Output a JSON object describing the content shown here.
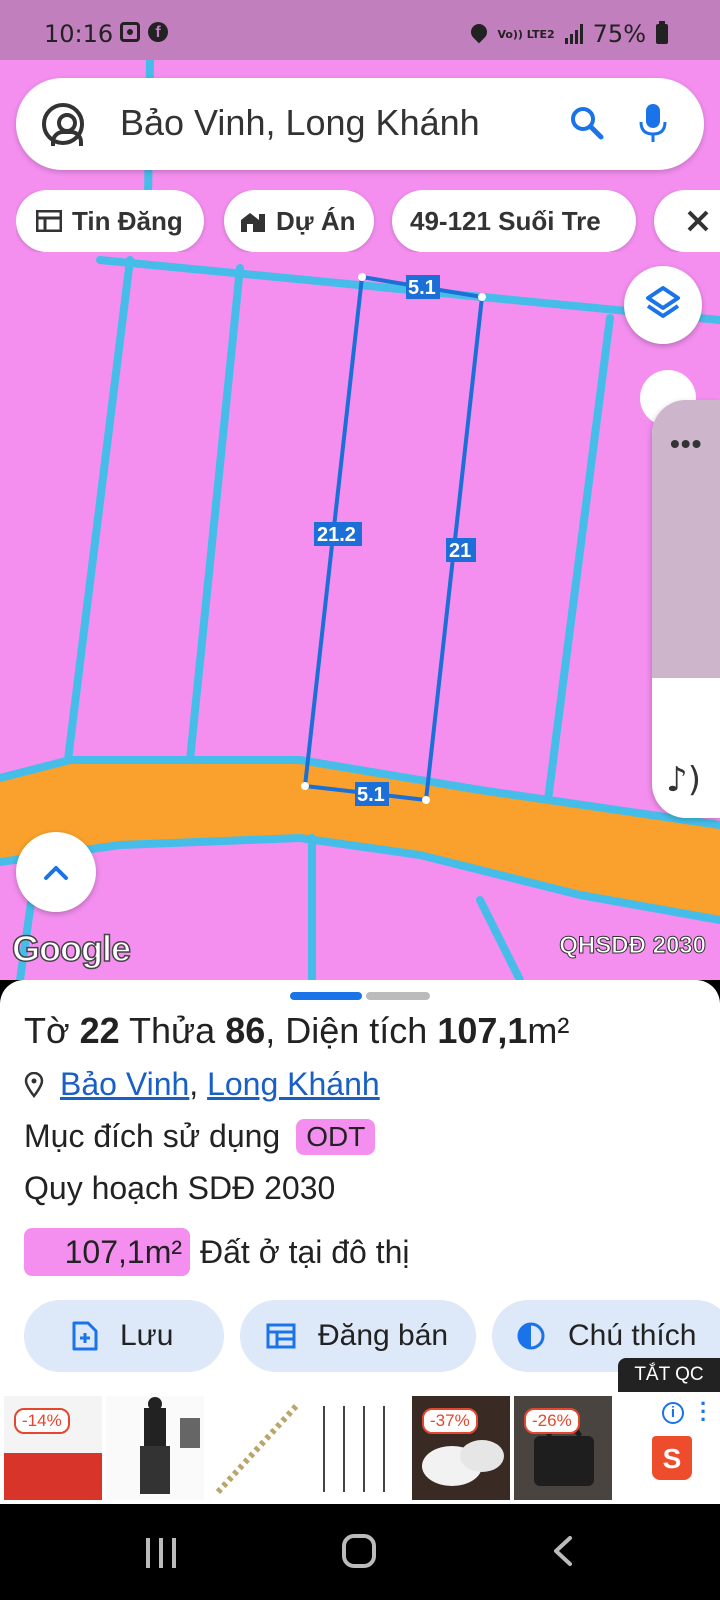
{
  "status_bar": {
    "time": "10:16",
    "network": "Vo)) LTE2",
    "battery": "75%"
  },
  "search": {
    "query": "Bảo Vinh, Long Khánh"
  },
  "chips": [
    {
      "label": "Tin Đăng"
    },
    {
      "label": "Dự Án"
    },
    {
      "label": "49-121 Suối Tre"
    }
  ],
  "map": {
    "edge_labels": [
      "5.1",
      "21.2",
      "21",
      "5.1"
    ],
    "attribution": "Google",
    "layer_label": "QHSDĐ 2030",
    "colors": {
      "residential": "#f48ff0",
      "road": "#f9a12c",
      "boundary": "#45bde8",
      "parcel": "#1b6fd6"
    }
  },
  "parcel": {
    "to_label": "Tờ",
    "to_value": "22",
    "thua_label": "Thửa",
    "thua_value": "86",
    "area_prefix": ", Diện tích",
    "area_value": "107,1",
    "area_unit": "m²",
    "ward": "Bảo Vinh",
    "separator": ",",
    "city": "Long Khánh",
    "purpose_label": "Mục đích sử dụng",
    "purpose_code": "ODT",
    "plan_label": "Quy hoạch SDĐ 2030",
    "plan_area": "107,1m²",
    "plan_type": "Đất ở tại đô thị"
  },
  "actions": [
    {
      "label": "Lưu",
      "icon": "add-file-icon"
    },
    {
      "label": "Đăng bán",
      "icon": "calendar-icon"
    },
    {
      "label": "Chú thích",
      "icon": "contrast-icon"
    }
  ],
  "ads": {
    "off_label": "TẮT QC",
    "badges": [
      "-14%",
      "-37%",
      "-26%"
    ],
    "shop_icon": "S"
  }
}
